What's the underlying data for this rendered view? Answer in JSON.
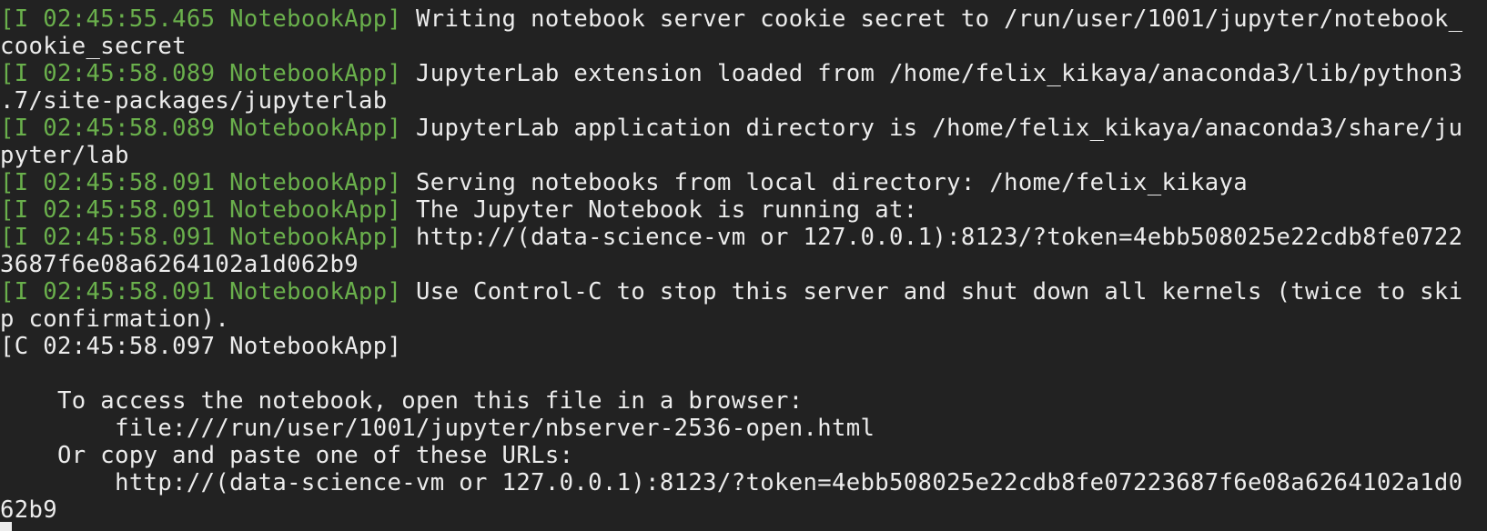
{
  "colors": {
    "background": "#222222",
    "text": "#ececec",
    "log_prefix_info": "#6ab04c"
  },
  "terminal": {
    "clipped_top_line": "                    ,   ,                                   ,",
    "lines": [
      {
        "prefix": "[I 02:45:55.465 NotebookApp]",
        "text": " Writing notebook server cookie secret to /run/user/1001/jupyter/notebook_"
      },
      {
        "prefix": "",
        "text": "cookie_secret"
      },
      {
        "prefix": "[I 02:45:58.089 NotebookApp]",
        "text": " JupyterLab extension loaded from /home/felix_kikaya/anaconda3/lib/python3"
      },
      {
        "prefix": "",
        "text": ".7/site-packages/jupyterlab"
      },
      {
        "prefix": "[I 02:45:58.089 NotebookApp]",
        "text": " JupyterLab application directory is /home/felix_kikaya/anaconda3/share/ju"
      },
      {
        "prefix": "",
        "text": "pyter/lab"
      },
      {
        "prefix": "[I 02:45:58.091 NotebookApp]",
        "text": " Serving notebooks from local directory: /home/felix_kikaya"
      },
      {
        "prefix": "[I 02:45:58.091 NotebookApp]",
        "text": " The Jupyter Notebook is running at:"
      },
      {
        "prefix": "[I 02:45:58.091 NotebookApp]",
        "text": " http://(data-science-vm or 127.0.0.1):8123/?token=4ebb508025e22cdb8fe0722"
      },
      {
        "prefix": "",
        "text": "3687f6e08a6264102a1d062b9"
      },
      {
        "prefix": "[I 02:45:58.091 NotebookApp]",
        "text": " Use Control-C to stop this server and shut down all kernels (twice to ski"
      },
      {
        "prefix": "",
        "text": "p confirmation)."
      },
      {
        "prefix": "",
        "text": "[C 02:45:58.097 NotebookApp]"
      },
      {
        "prefix": "",
        "text": ""
      },
      {
        "prefix": "",
        "text": "    To access the notebook, open this file in a browser:"
      },
      {
        "prefix": "",
        "text": "        file:///run/user/1001/jupyter/nbserver-2536-open.html"
      },
      {
        "prefix": "",
        "text": "    Or copy and paste one of these URLs:"
      },
      {
        "prefix": "",
        "text": "        http://(data-science-vm or 127.0.0.1):8123/?token=4ebb508025e22cdb8fe07223687f6e08a6264102a1d0"
      },
      {
        "prefix": "",
        "text": "62b9"
      }
    ]
  }
}
